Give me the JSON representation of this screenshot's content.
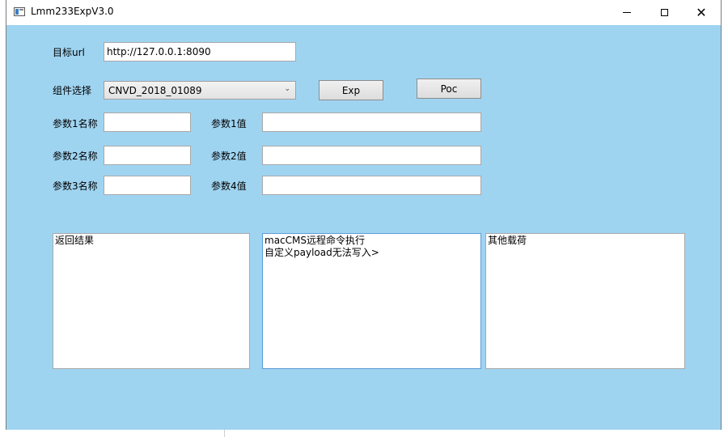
{
  "window": {
    "title": "Lmm233ExpV3.0",
    "icon": "app-icon",
    "controls": {
      "minimize": "minimize-icon",
      "maximize": "maximize-icon",
      "close": "close-icon",
      "close_glyph": "✕"
    }
  },
  "colors": {
    "client_background": "#9fd4f1",
    "focused_border": "#5b9bd5"
  },
  "form": {
    "url": {
      "label": "目标url",
      "value": "http://127.0.0.1:8090"
    },
    "component": {
      "label": "组件选择",
      "selected": "CNVD_2018_01089"
    },
    "buttons": {
      "exp": "Exp",
      "poc": "Poc"
    },
    "params": [
      {
        "name_label": "参数1名称",
        "name_value": "",
        "value_label": "参数1值",
        "value_value": ""
      },
      {
        "name_label": "参数2名称",
        "name_value": "",
        "value_label": "参数2值",
        "value_value": ""
      },
      {
        "name_label": "参数3名称",
        "name_value": "",
        "value_label": "参数4值",
        "value_value": ""
      }
    ]
  },
  "panels": {
    "result": {
      "lines": [
        "返回结果"
      ]
    },
    "info": {
      "lines": [
        "macCMS远程命令执行",
        "自定义payload无法写入>"
      ]
    },
    "other_payload": {
      "lines": [
        "其他载荷"
      ]
    }
  }
}
